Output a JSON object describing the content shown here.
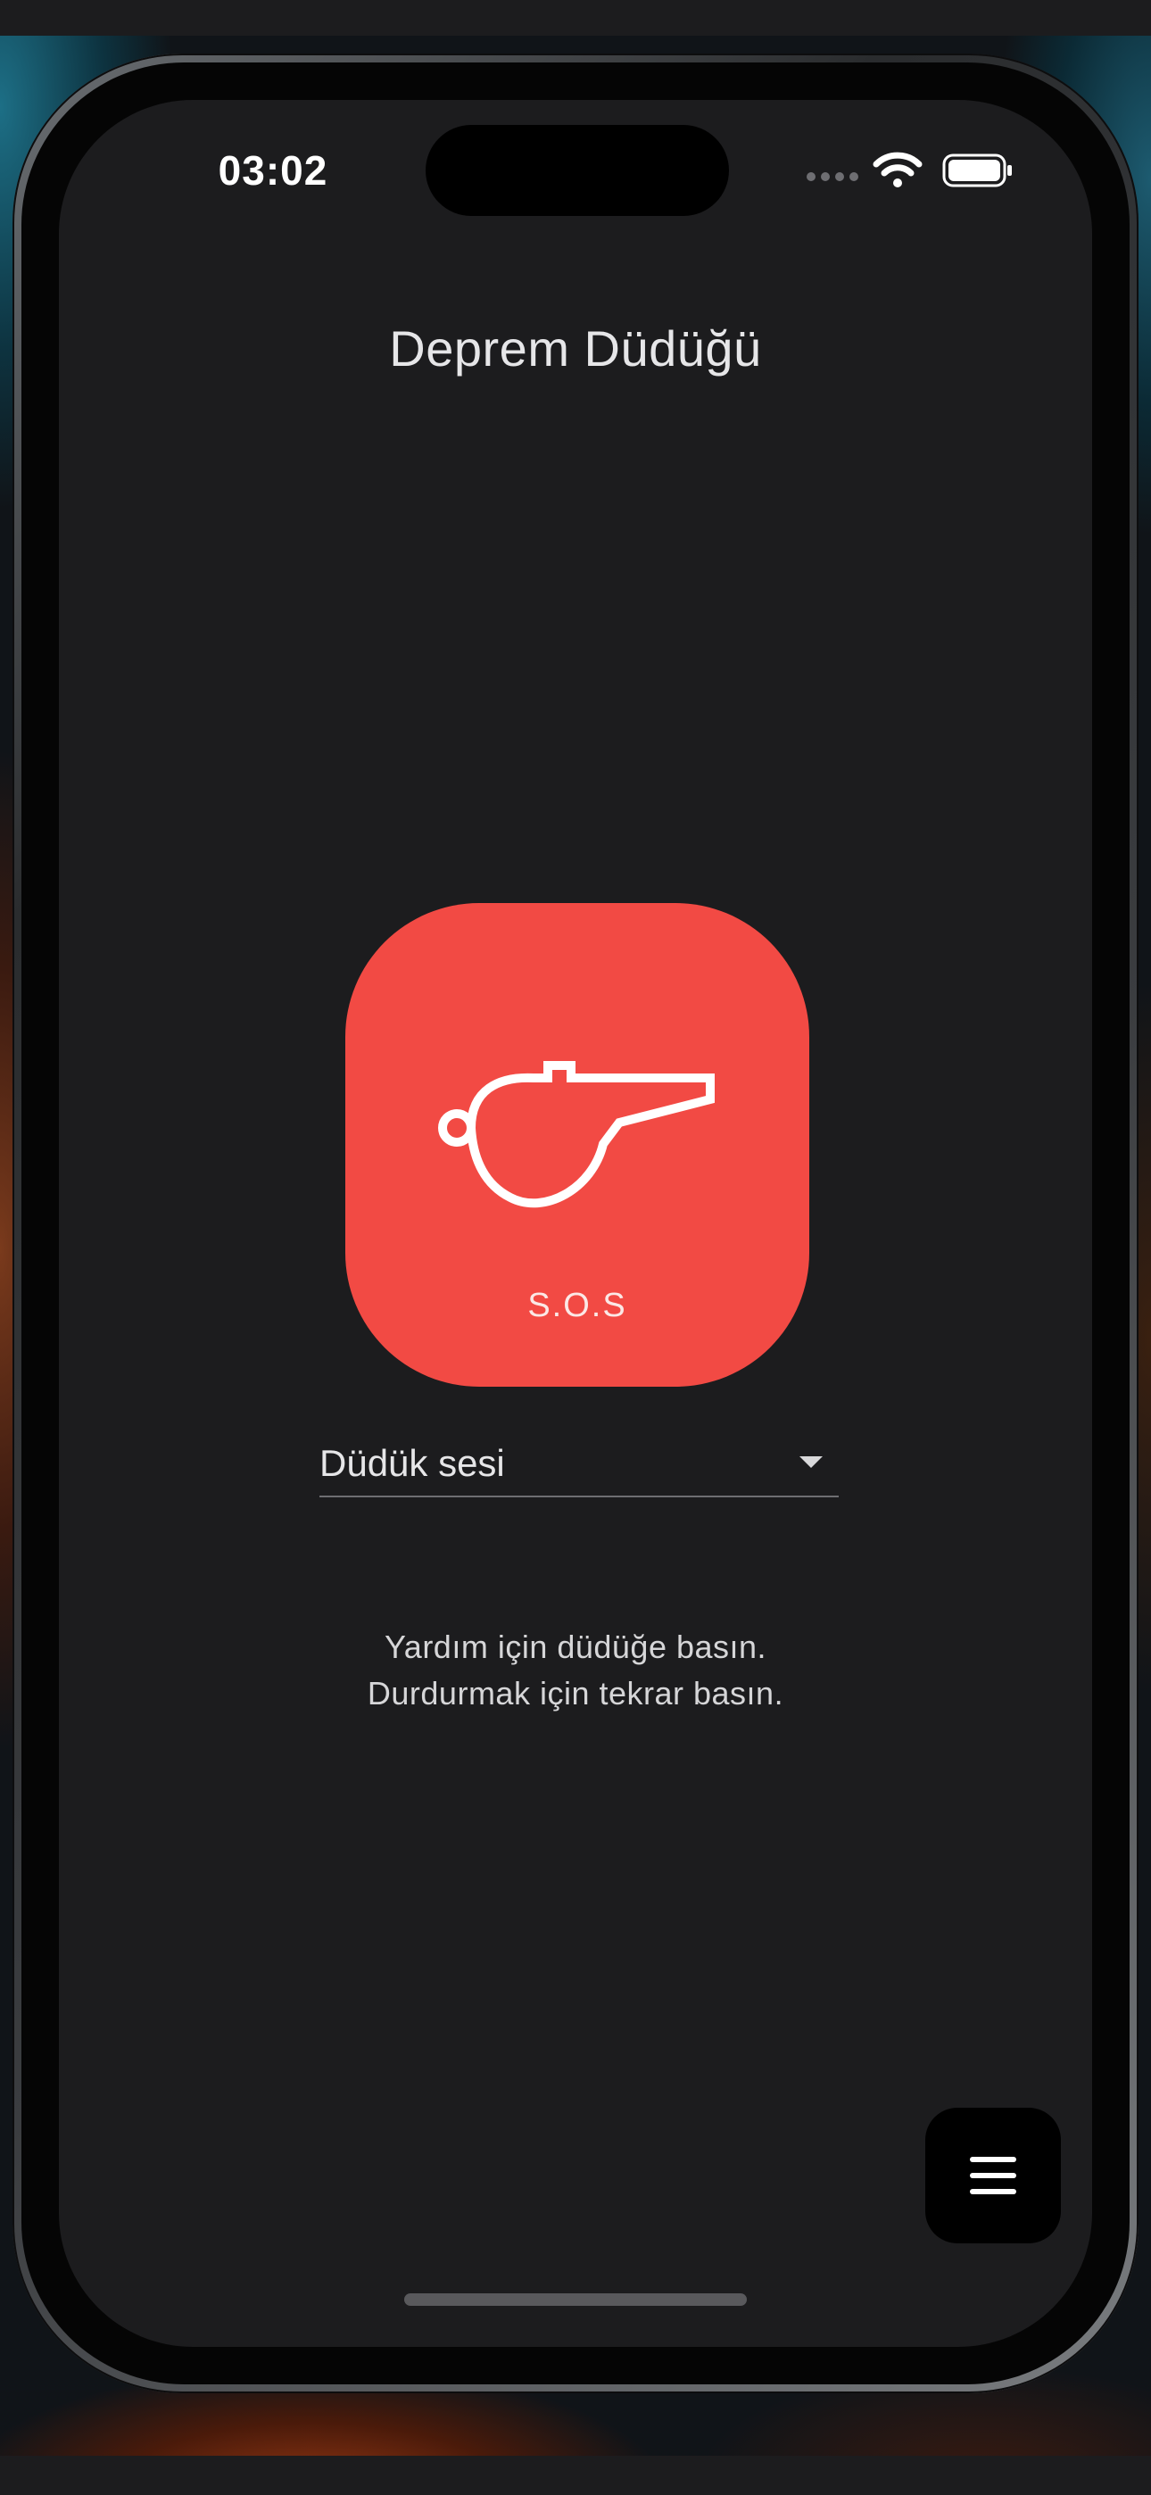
{
  "status_bar": {
    "time": "03:02",
    "wifi_icon": "wifi-icon",
    "battery_icon": "battery-icon"
  },
  "app": {
    "title": "Deprem Düdüğü"
  },
  "sos_button": {
    "icon": "whistle-icon",
    "label": "S.O.S",
    "color": "#f24a44"
  },
  "sound_select": {
    "selected": "Düdük sesi",
    "icon": "chevron-down-icon"
  },
  "help": {
    "line1": "Yardım için düdüğe basın.",
    "line2": "Durdurmak için tekrar basın."
  },
  "menu_button": {
    "icon": "menu-icon"
  },
  "colors": {
    "background": "#1c1c1e",
    "accent": "#f24a44",
    "fab": "#000000"
  }
}
